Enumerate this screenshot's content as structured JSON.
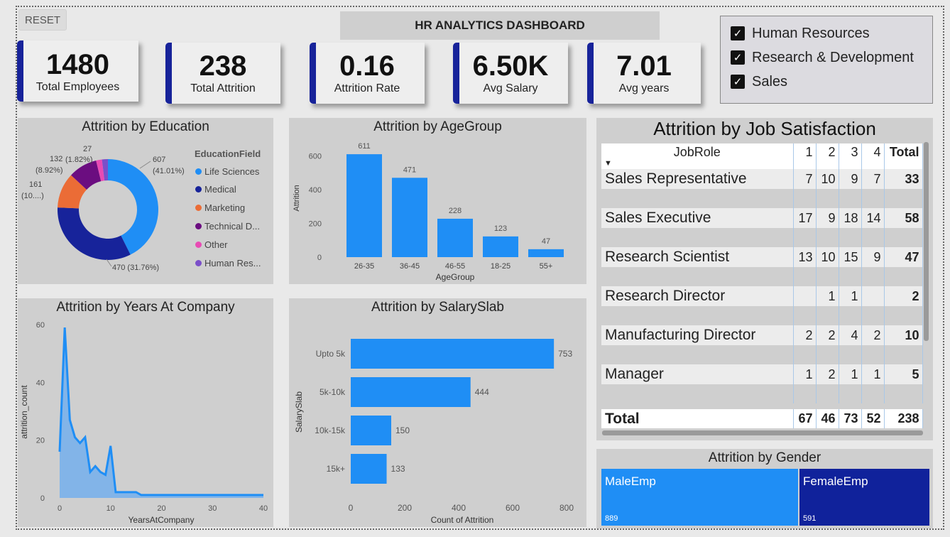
{
  "reset_label": "RESET",
  "dashboard_title": "HR ANALYTICS DASHBOARD",
  "kpis": [
    {
      "value": "1480",
      "label": "Total Employees"
    },
    {
      "value": "238",
      "label": "Total Attrition"
    },
    {
      "value": "0.16",
      "label": "Attrition Rate"
    },
    {
      "value": "6.50K",
      "label": "Avg Salary"
    },
    {
      "value": "7.01",
      "label": "Avg years"
    }
  ],
  "slicer": {
    "items": [
      {
        "label": "Human Resources",
        "checked": true
      },
      {
        "label": "Research & Development",
        "checked": true
      },
      {
        "label": "Sales",
        "checked": true
      }
    ],
    "check_glyph": "✓"
  },
  "education": {
    "title": "Attrition by Education",
    "legend_title": "EducationField",
    "items": [
      {
        "label": "Life Sciences",
        "color": "#1f8ef5"
      },
      {
        "label": "Medical",
        "color": "#17239a"
      },
      {
        "label": "Marketing",
        "color": "#eb6c36"
      },
      {
        "label": "Technical D...",
        "color": "#6b0d80"
      },
      {
        "label": "Other",
        "color": "#e84bb4"
      },
      {
        "label": "Human Res...",
        "color": "#7b4fc9"
      }
    ],
    "annotations": {
      "ls_value": "607",
      "ls_pct": "(41.01%)",
      "med": "470 (31.76%)",
      "mkt_value": "161",
      "mkt_pct": "(10....)",
      "tech_value": "132",
      "tech_pct": "(8.92%)",
      "other": "(1.82%)",
      "hr": "27"
    }
  },
  "agegroup": {
    "title": "Attrition by AgeGroup"
  },
  "years": {
    "title": "Attrition by Years At Company"
  },
  "salary": {
    "title": "Attrition by SalarySlab"
  },
  "job_satisfaction": {
    "title": "Attrition by Job Satisfaction",
    "headers": [
      "JobRole",
      "1",
      "2",
      "3",
      "4",
      "Total"
    ],
    "rows": [
      {
        "role": "Sales Representative",
        "c1": "7",
        "c2": "10",
        "c3": "9",
        "c4": "7",
        "total": "33"
      },
      {
        "role": "Sales Executive",
        "c1": "17",
        "c2": "9",
        "c3": "18",
        "c4": "14",
        "total": "58"
      },
      {
        "role": "Research Scientist",
        "c1": "13",
        "c2": "10",
        "c3": "15",
        "c4": "9",
        "total": "47"
      },
      {
        "role": "Research Director",
        "c1": "",
        "c2": "1",
        "c3": "1",
        "c4": "",
        "total": "2"
      },
      {
        "role": "Manufacturing Director",
        "c1": "2",
        "c2": "2",
        "c3": "4",
        "c4": "2",
        "total": "10"
      },
      {
        "role": "Manager",
        "c1": "1",
        "c2": "2",
        "c3": "1",
        "c4": "1",
        "total": "5"
      }
    ],
    "total_row": {
      "label": "Total",
      "c1": "67",
      "c2": "46",
      "c3": "73",
      "c4": "52",
      "total": "238"
    }
  },
  "gender": {
    "title": "Attrition by Gender",
    "male": {
      "label": "MaleEmp",
      "value": "889",
      "color": "#1f8ef5"
    },
    "female": {
      "label": "FemaleEmp",
      "value": "591",
      "color": "#10229b"
    }
  },
  "chart_data": [
    {
      "type": "pie",
      "title": "Attrition by Education",
      "legend_title": "EducationField",
      "categories": [
        "Life Sciences",
        "Medical",
        "Marketing",
        "Technical D...",
        "Other",
        "Human Res..."
      ],
      "values": [
        607,
        470,
        161,
        132,
        27,
        27
      ],
      "colors": [
        "#1f8ef5",
        "#17239a",
        "#eb6c36",
        "#6b0d80",
        "#e84bb4",
        "#7b4fc9"
      ]
    },
    {
      "type": "bar",
      "title": "Attrition by AgeGroup",
      "categories": [
        "26-35",
        "36-45",
        "46-55",
        "18-25",
        "55+"
      ],
      "values": [
        611,
        471,
        228,
        123,
        47
      ],
      "xlabel": "AgeGroup",
      "ylabel": "Attrition",
      "yticks": [
        0,
        200,
        400,
        600
      ],
      "ylim": [
        0,
        700
      ]
    },
    {
      "type": "area",
      "title": "Attrition by Years At Company",
      "xlabel": "YearsAtCompany",
      "ylabel": "attrition_count",
      "x": [
        0,
        1,
        2,
        3,
        4,
        5,
        6,
        7,
        8,
        9,
        10,
        11,
        12,
        13,
        14,
        15,
        16,
        17,
        18,
        19,
        20,
        21,
        22,
        23,
        24,
        25,
        26,
        27,
        28,
        29,
        30,
        31,
        32,
        33,
        34,
        35,
        36,
        37,
        38,
        39,
        40
      ],
      "y": [
        16,
        59,
        27,
        21,
        19,
        21,
        9,
        11,
        9,
        8,
        18,
        2,
        2,
        2,
        2,
        2,
        1,
        1,
        1,
        1,
        1,
        1,
        1,
        1,
        1,
        1,
        1,
        1,
        1,
        1,
        1,
        1,
        1,
        1,
        1,
        1,
        1,
        1,
        1,
        1,
        1
      ],
      "xticks": [
        0,
        10,
        20,
        30,
        40
      ],
      "yticks": [
        0,
        20,
        40,
        60
      ],
      "xlim": [
        0,
        40
      ],
      "ylim": [
        0,
        60
      ]
    },
    {
      "type": "bar",
      "orientation": "horizontal",
      "title": "Attrition by SalarySlab",
      "categories": [
        "Upto 5k",
        "5k-10k",
        "10k-15k",
        "15k+"
      ],
      "values": [
        753,
        444,
        150,
        133
      ],
      "xlabel": "Count of Attrition",
      "ylabel": "SalarySlab",
      "xticks": [
        0,
        200,
        400,
        600,
        800
      ],
      "xlim": [
        0,
        800
      ]
    }
  ]
}
